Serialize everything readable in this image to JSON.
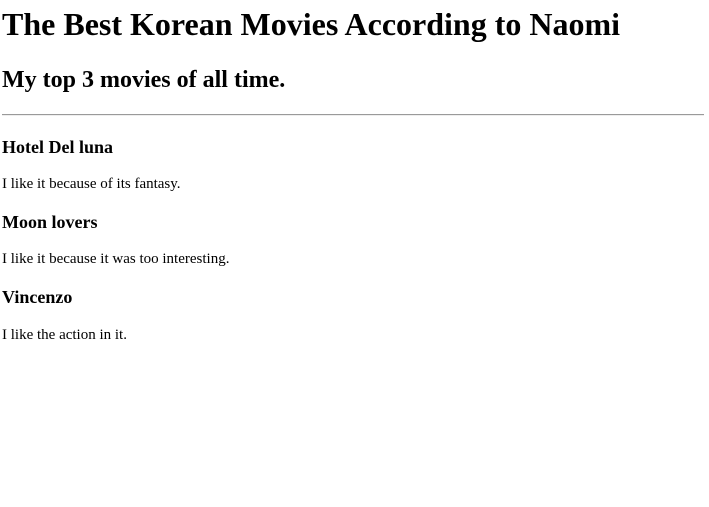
{
  "page": {
    "title": "The Best Korean Movies According to Naomi",
    "subtitle": "My top 3 movies of all time."
  },
  "movies": [
    {
      "name": "Hotel Del luna",
      "reason": "I like it because of its fantasy."
    },
    {
      "name": "Moon lovers",
      "reason": "I like it because it was too interesting."
    },
    {
      "name": "Vincenzo",
      "reason": "I like the action in it."
    }
  ]
}
